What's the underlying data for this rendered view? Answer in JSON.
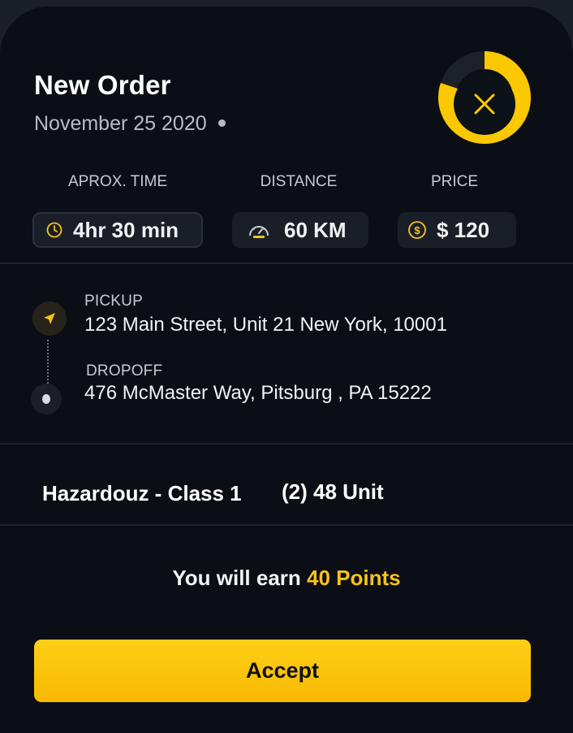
{
  "order": {
    "title": "New Order",
    "date": "November 25 2020"
  },
  "timer": {
    "progress_fraction": 0.8,
    "accent_color": "#fcc800",
    "close_icon": "close-icon"
  },
  "stats": {
    "time": {
      "label": "APROX. TIME",
      "value": "4hr 30 min",
      "icon": "clock-icon"
    },
    "distance": {
      "label": "DISTANCE",
      "value": "60 KM",
      "icon": "speedometer-icon"
    },
    "price": {
      "label": "PRICE",
      "value": "$ 120",
      "icon": "dollar-coin-icon"
    }
  },
  "route": {
    "pickup_label": "PICKUP",
    "pickup_address": "123 Main Street, Unit 21 New York, 10001",
    "dropoff_label": "DROPOFF",
    "dropoff_address": "476 McMaster Way, Pitsburg , PA 15222"
  },
  "cargo": {
    "class": "Hazardouz - Class 1",
    "units": "(2) 48 Unit"
  },
  "earn": {
    "prefix": "You will earn",
    "points": "40 Points"
  },
  "actions": {
    "accept_label": "Accept"
  },
  "colors": {
    "accent": "#fcc800",
    "background": "#0b0f15"
  }
}
